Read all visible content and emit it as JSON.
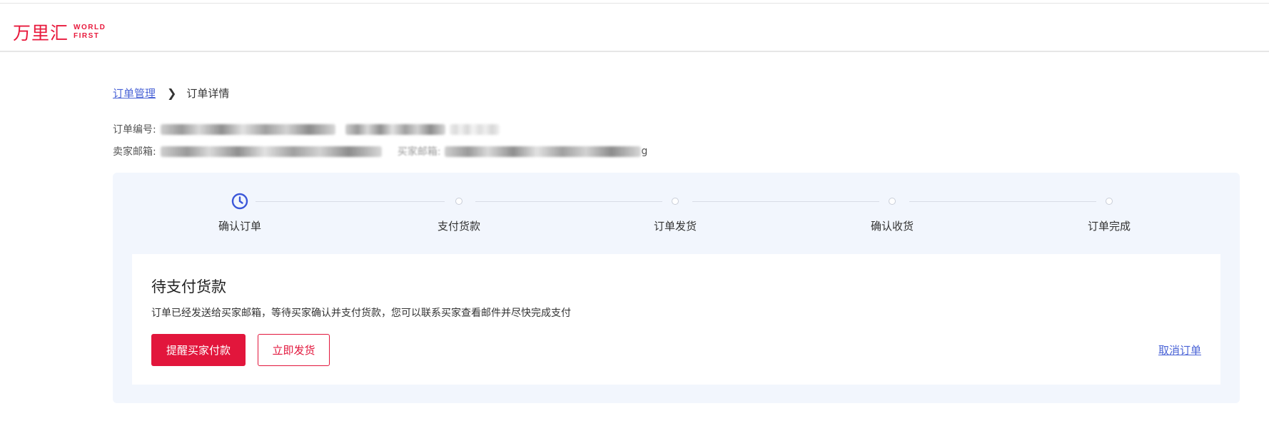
{
  "header": {
    "logo_cn": "万里汇",
    "logo_en_line1": "WORLD",
    "logo_en_line2": "FIRST",
    "brand_color": "#e8193c"
  },
  "breadcrumb": {
    "parent": "订单管理",
    "current": "订单详情"
  },
  "order_meta": {
    "order_no_label": "订单编号:",
    "seller_email_label": "卖家邮箱:",
    "buyer_email_label": "买家邮箱:",
    "buyer_email_tail": "g"
  },
  "steps": [
    {
      "label": "确认订单",
      "state": "current",
      "icon": "clock-icon"
    },
    {
      "label": "支付货款",
      "state": "pending"
    },
    {
      "label": "订单发货",
      "state": "pending"
    },
    {
      "label": "确认收货",
      "state": "pending"
    },
    {
      "label": "订单完成",
      "state": "pending"
    }
  ],
  "status_card": {
    "title": "待支付货款",
    "description": "订单已经发送给买家邮箱，等待买家确认并支付货款，您可以联系买家查看邮件并尽快完成支付",
    "primary_button": "提醒买家付款",
    "secondary_button": "立即发货",
    "cancel_link": "取消订单"
  },
  "colors": {
    "accent_red": "#e2163c",
    "link_blue": "#4a63d6",
    "panel_bg": "#f2f6fd"
  }
}
